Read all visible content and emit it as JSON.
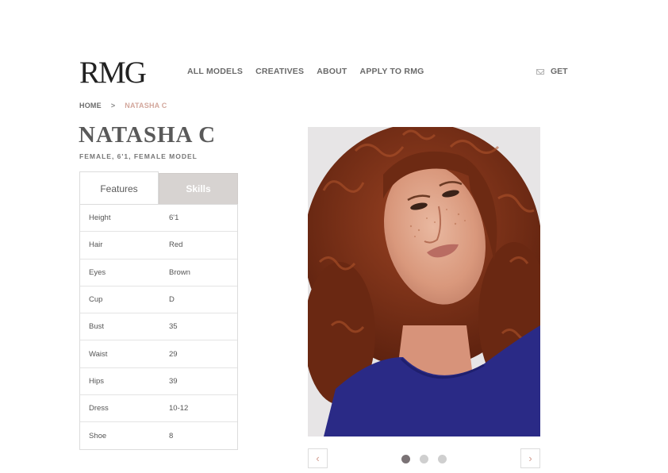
{
  "header": {
    "logo_text": "RMG",
    "nav": [
      "ALL MODELS",
      "CREATIVES",
      "ABOUT",
      "APPLY TO RMG"
    ],
    "get_label": "GET",
    "get_icon": "mail-icon"
  },
  "breadcrumb": {
    "home": "HOME",
    "separator": ">",
    "current": "NATASHA C"
  },
  "model": {
    "name": "NATASHA C",
    "subtitle": "FEMALE, 6'1, FEMALE MODEL"
  },
  "tabs": {
    "features": "Features",
    "skills": "Skills",
    "active": "Features"
  },
  "features": [
    {
      "label": "Height",
      "value": "6'1"
    },
    {
      "label": "Hair",
      "value": "Red"
    },
    {
      "label": "Eyes",
      "value": "Brown"
    },
    {
      "label": "Cup",
      "value": "D"
    },
    {
      "label": "Bust",
      "value": "35"
    },
    {
      "label": "Waist",
      "value": "29"
    },
    {
      "label": "Hips",
      "value": "39"
    },
    {
      "label": "Dress",
      "value": "10-12"
    },
    {
      "label": "Shoe",
      "value": "8"
    }
  ],
  "carousel": {
    "prev": "‹",
    "next": "›",
    "slides": 3,
    "active_index": 0
  },
  "colors": {
    "accent": "#d3a79c",
    "skills_tab_bg": "#d7d3d1",
    "shirt": "#2a2a86",
    "hair": "#7a2e14"
  }
}
